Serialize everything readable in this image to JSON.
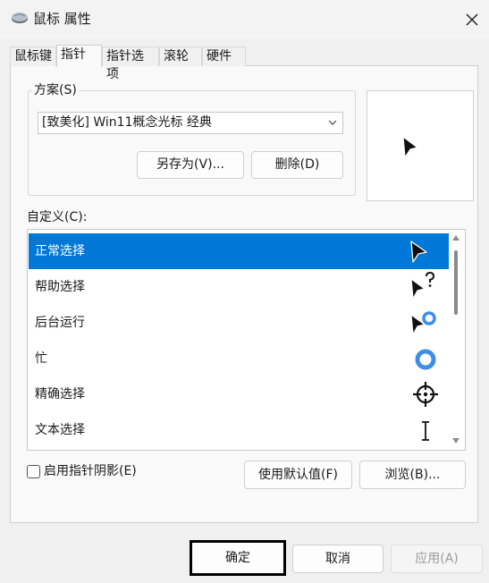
{
  "window": {
    "title": "鼠标 属性",
    "icon": "mouse-icon",
    "close_icon": "close-icon"
  },
  "tabs": [
    {
      "label": "鼠标键",
      "active": false
    },
    {
      "label": "指针",
      "active": true
    },
    {
      "label": "指针选项",
      "active": false
    },
    {
      "label": "滚轮",
      "active": false
    },
    {
      "label": "硬件",
      "active": false
    }
  ],
  "scheme": {
    "group_label": "方案(S)",
    "selected": "[致美化] Win11概念光标 经典",
    "save_as_label": "另存为(V)...",
    "delete_label": "删除(D)"
  },
  "customize": {
    "label": "自定义(C):",
    "items": [
      {
        "label": "正常选择",
        "icon": "arrow-cursor-icon",
        "selected": true
      },
      {
        "label": "帮助选择",
        "icon": "help-cursor-icon",
        "selected": false
      },
      {
        "label": "后台运行",
        "icon": "working-in-background-cursor-icon",
        "selected": false
      },
      {
        "label": "忙",
        "icon": "busy-cursor-icon",
        "selected": false
      },
      {
        "label": "精确选择",
        "icon": "crosshair-cursor-icon",
        "selected": false
      },
      {
        "label": "文本选择",
        "icon": "text-cursor-icon",
        "selected": false
      }
    ]
  },
  "shadow": {
    "label": "启用指针阴影(E)",
    "checked": false
  },
  "use_default_label": "使用默认值(F)",
  "browse_label": "浏览(B)...",
  "footer": {
    "ok_label": "确定",
    "cancel_label": "取消",
    "apply_label": "应用(A)"
  },
  "colors": {
    "selection": "#0078d7",
    "busy_ring": "#3d8ee6"
  }
}
